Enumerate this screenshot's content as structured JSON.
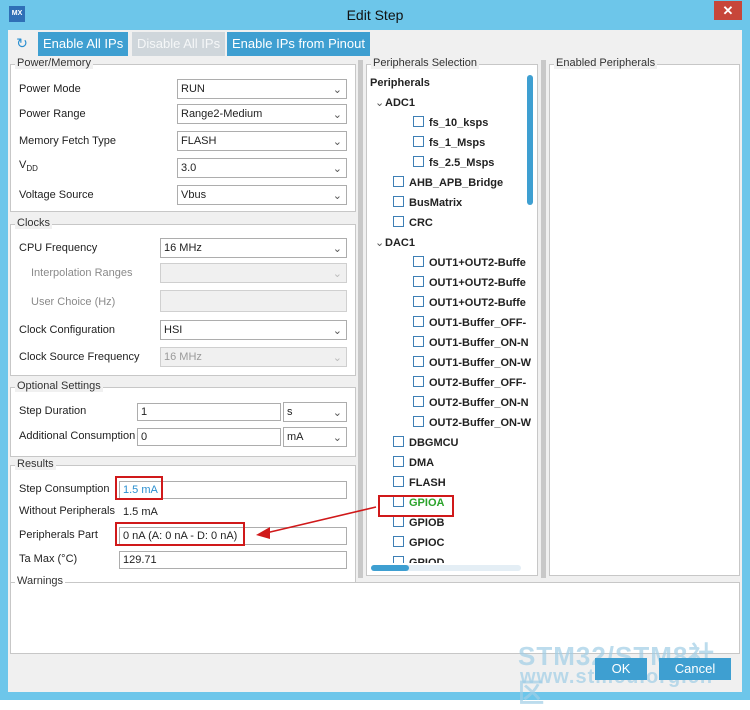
{
  "window": {
    "title": "Edit Step",
    "app_icon": "MX",
    "close_glyph": "✕"
  },
  "toolbar": {
    "refresh_glyph": "↻",
    "enable_all": "Enable All IPs",
    "disable_all": "Disable All IPs",
    "enable_pinout": "Enable IPs from Pinout"
  },
  "power": {
    "title": "Power/Memory",
    "mode_label": "Power Mode",
    "mode_value": "RUN",
    "range_label": "Power Range",
    "range_value": "Range2-Medium",
    "fetch_label": "Memory Fetch Type",
    "fetch_value": "FLASH",
    "vdd_label": "V",
    "vdd_sub": "DD",
    "vdd_value": "3.0",
    "source_label": "Voltage Source",
    "source_value": "Vbus"
  },
  "clocks": {
    "title": "Clocks",
    "cpu_label": "CPU Frequency",
    "cpu_value": "16 MHz",
    "interp_label": "Interpolation Ranges",
    "interp_value": "",
    "user_label": "User Choice (Hz)",
    "user_value": "",
    "config_label": "Clock Configuration",
    "config_value": "HSI",
    "srcfreq_label": "Clock Source Frequency",
    "srcfreq_value": "16 MHz"
  },
  "optional": {
    "title": "Optional Settings",
    "duration_label": "Step Duration",
    "duration_value": "1",
    "duration_unit": "s",
    "consumption_label": "Additional Consumption",
    "consumption_value": "0",
    "consumption_unit": "mA"
  },
  "results": {
    "title": "Results",
    "step_label": "Step Consumption",
    "step_value": "1.5 mA",
    "without_label": "Without Peripherals",
    "without_value": "1.5 mA",
    "periph_label": "Peripherals Part",
    "periph_value": "0 nA  (A: 0 nA - D: 0 nA)",
    "ta_label": "Ta Max (°C)",
    "ta_value": "129.71"
  },
  "peripherals": {
    "title": "Peripherals Selection",
    "root": "Peripherals",
    "items": [
      {
        "label": "ADC1",
        "expander": "⌄",
        "checkbox": false
      },
      {
        "label": "fs_10_ksps",
        "expander": "",
        "checkbox": true
      },
      {
        "label": "fs_1_Msps",
        "expander": "",
        "checkbox": true
      },
      {
        "label": "fs_2.5_Msps",
        "expander": "",
        "checkbox": true
      },
      {
        "label": "AHB_APB_Bridge",
        "expander": "",
        "checkbox": true
      },
      {
        "label": "BusMatrix",
        "expander": "",
        "checkbox": true
      },
      {
        "label": "CRC",
        "expander": "",
        "checkbox": true
      },
      {
        "label": "DAC1",
        "expander": "⌄",
        "checkbox": false
      },
      {
        "label": "OUT1+OUT2-Buffe",
        "expander": "",
        "checkbox": true
      },
      {
        "label": "OUT1+OUT2-Buffe",
        "expander": "",
        "checkbox": true
      },
      {
        "label": "OUT1+OUT2-Buffe",
        "expander": "",
        "checkbox": true
      },
      {
        "label": "OUT1-Buffer_OFF-",
        "expander": "",
        "checkbox": true
      },
      {
        "label": "OUT1-Buffer_ON-N",
        "expander": "",
        "checkbox": true
      },
      {
        "label": "OUT1-Buffer_ON-W",
        "expander": "",
        "checkbox": true
      },
      {
        "label": "OUT2-Buffer_OFF-",
        "expander": "",
        "checkbox": true
      },
      {
        "label": "OUT2-Buffer_ON-N",
        "expander": "",
        "checkbox": true
      },
      {
        "label": "OUT2-Buffer_ON-W",
        "expander": "",
        "checkbox": true
      },
      {
        "label": "DBGMCU",
        "expander": "",
        "checkbox": true
      },
      {
        "label": "DMA",
        "expander": "",
        "checkbox": true
      },
      {
        "label": "FLASH",
        "expander": "",
        "checkbox": true
      },
      {
        "label": "GPIOA",
        "expander": "",
        "checkbox": true,
        "highlight": true
      },
      {
        "label": "GPIOB",
        "expander": "",
        "checkbox": true
      },
      {
        "label": "GPIOC",
        "expander": "",
        "checkbox": true
      },
      {
        "label": "GPIOD",
        "expander": "",
        "checkbox": true
      }
    ]
  },
  "enabled": {
    "title": "Enabled Peripherals"
  },
  "warnings": {
    "title": "Warnings"
  },
  "buttons": {
    "ok": "OK",
    "cancel": "Cancel"
  },
  "watermark": {
    "line1": "STM32/STM8社区",
    "line2": "www.stmcu.org.cn"
  },
  "colors": {
    "accent": "#3e9fd1",
    "highlight": "#d0191a",
    "gpioa": "#2ca32c",
    "titlebar": "#6dc6ea"
  }
}
